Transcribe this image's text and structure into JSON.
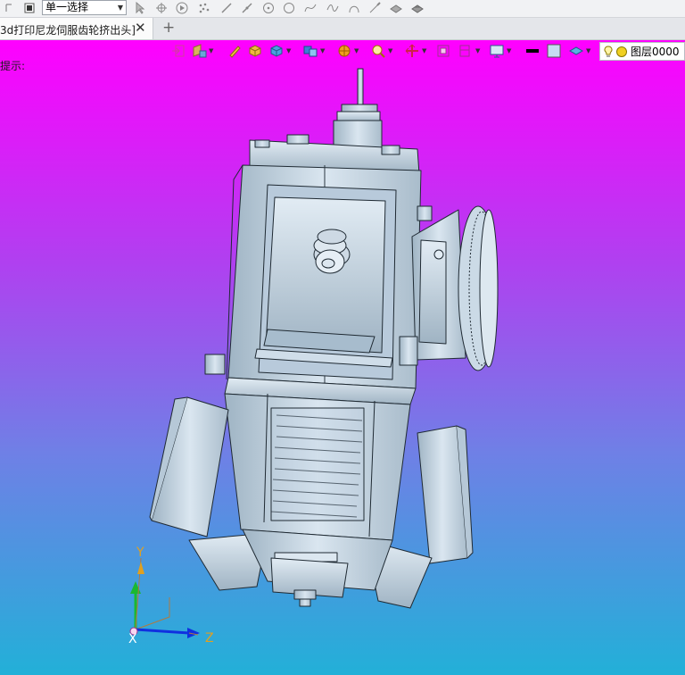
{
  "toolbar": {
    "select_filter": "单一选择"
  },
  "document": {
    "tab_title": "3d打印尼龙伺服齿轮挤出头]",
    "close_glyph": "✕",
    "new_tab_glyph": "+"
  },
  "viewport": {
    "hint": "提示:",
    "layer_name": "图层0000"
  },
  "triad": {
    "y_label": "Y",
    "z_label": "Z",
    "x_label": "X"
  },
  "colors": {
    "background_top": "#ff00ff",
    "background_bottom": "#22b0d8",
    "model_fill": "#c7d7e6",
    "model_edge": "#1f2a33"
  }
}
